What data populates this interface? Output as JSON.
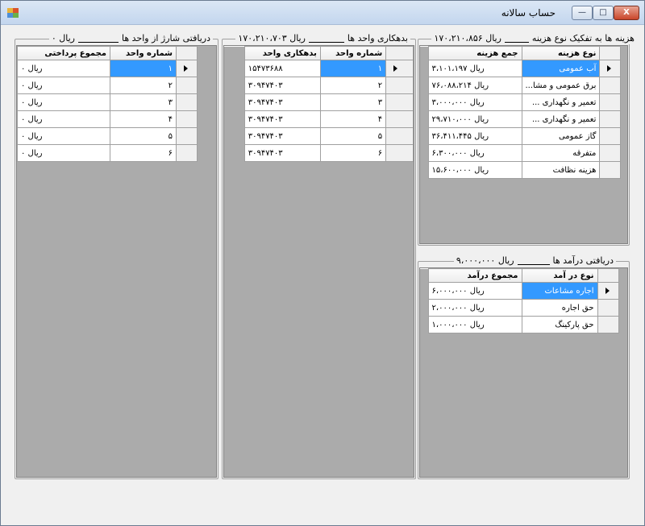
{
  "window": {
    "title": "حساب سالانه",
    "close_label": "X",
    "max_label": "□",
    "min_label": "—"
  },
  "groups": {
    "unit_payments": {
      "label_prefix": "دریافتی شارژ از واحد ها",
      "label_value": "ریال ۰",
      "headers": [
        "شماره واحد",
        "مجموع پرداختی"
      ],
      "rows": [
        {
          "unit": "۱",
          "amount": "ریال ۰"
        },
        {
          "unit": "۲",
          "amount": "ریال ۰"
        },
        {
          "unit": "۳",
          "amount": "ریال ۰"
        },
        {
          "unit": "۴",
          "amount": "ریال ۰"
        },
        {
          "unit": "۵",
          "amount": "ریال ۰"
        },
        {
          "unit": "۶",
          "amount": "ریال ۰"
        }
      ]
    },
    "unit_debts": {
      "label_prefix": "بدهکاری واحد ها",
      "label_value": "ریال ۱۷۰،۲۱۰،۷۰۳",
      "headers": [
        "شماره واحد",
        "بدهکاری واحد"
      ],
      "rows": [
        {
          "unit": "۱",
          "amount": "۱۵۴۷۳۶۸۸"
        },
        {
          "unit": "۲",
          "amount": "۳۰۹۴۷۴۰۳"
        },
        {
          "unit": "۳",
          "amount": "۳۰۹۴۷۴۰۳"
        },
        {
          "unit": "۴",
          "amount": "۳۰۹۴۷۴۰۳"
        },
        {
          "unit": "۵",
          "amount": "۳۰۹۴۷۴۰۳"
        },
        {
          "unit": "۶",
          "amount": "۳۰۹۴۷۴۰۳"
        }
      ]
    },
    "expenses": {
      "label_prefix": "هزینه ها به تفکیک نوع هزینه",
      "label_value": "ریال ۱۷۰،۲۱۰،۸۵۶",
      "headers": [
        "نوع هزینه",
        "جمع هزینه"
      ],
      "rows": [
        {
          "type": "آب عمومی",
          "amount": "ریال ۳،۱۰۱،۱۹۷"
        },
        {
          "type": "برق عمومی و مشا...",
          "amount": "ریال ۷۶،۰۸۸،۲۱۴"
        },
        {
          "type": "تعمیر و نگهداری ...",
          "amount": "ریال ۳،۰۰۰،۰۰۰"
        },
        {
          "type": "تعمیر و نگهداری ...",
          "amount": "ریال ۲۹،۷۱۰،۰۰۰"
        },
        {
          "type": "گاز عمومی",
          "amount": "ریال ۳۶،۴۱۱،۴۴۵"
        },
        {
          "type": "متفرقه",
          "amount": "ریال ۶،۳۰۰،۰۰۰"
        },
        {
          "type": "هزینه نظافت",
          "amount": "ریال ۱۵،۶۰۰،۰۰۰"
        }
      ]
    },
    "income": {
      "label_prefix": "دریافتی درآمد ها",
      "label_value": "ریال ۹،۰۰۰،۰۰۰",
      "headers": [
        "نوع در آمد",
        "مجموع درآمد"
      ],
      "rows": [
        {
          "type": "اجاره مشاعات",
          "amount": "ریال ۶،۰۰۰،۰۰۰"
        },
        {
          "type": "حق اجاره",
          "amount": "ریال ۲،۰۰۰،۰۰۰"
        },
        {
          "type": "حق پارکینگ",
          "amount": "ریال ۱،۰۰۰،۰۰۰"
        }
      ]
    }
  },
  "colors": {
    "selection": "#3399ff",
    "grid_bg": "#ababab",
    "window_bg": "#f0f0f0"
  }
}
